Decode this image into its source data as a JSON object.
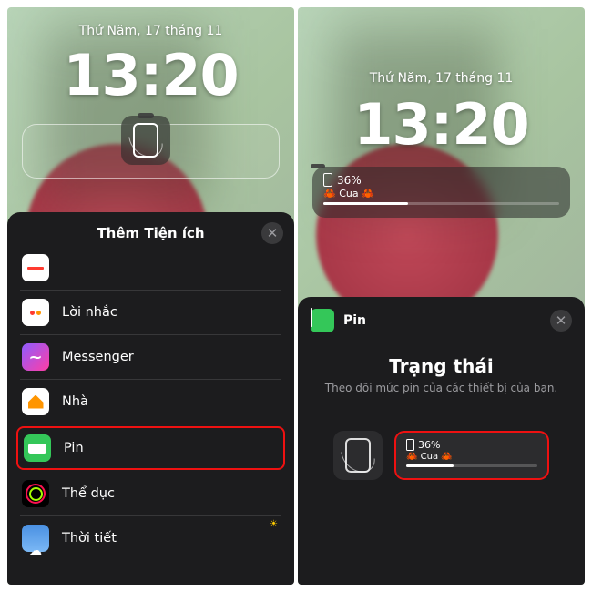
{
  "left": {
    "date": "Thứ Năm, 17 tháng 11",
    "time": "13:20",
    "sheet_title": "Thêm Tiện ích",
    "items": [
      {
        "label": "Lời nhắc",
        "icon": "reminders"
      },
      {
        "label": "Messenger",
        "icon": "messenger"
      },
      {
        "label": "Nhà",
        "icon": "home"
      },
      {
        "label": "Pin",
        "icon": "battery",
        "highlighted": true
      },
      {
        "label": "Thể dục",
        "icon": "fitness"
      },
      {
        "label": "Thời tiết",
        "icon": "weather"
      }
    ]
  },
  "right": {
    "date": "Thứ Năm, 17 tháng 11",
    "time": "13:20",
    "battery_pct": "36%",
    "device_name": "🦀 Cua 🦀",
    "sheet_app": "Pin",
    "detail_title": "Trạng thái",
    "detail_sub": "Theo dõi mức pin của các thiết bị của bạn.",
    "preview_pct": "36%",
    "preview_dev": "🦀 Cua 🦀"
  }
}
